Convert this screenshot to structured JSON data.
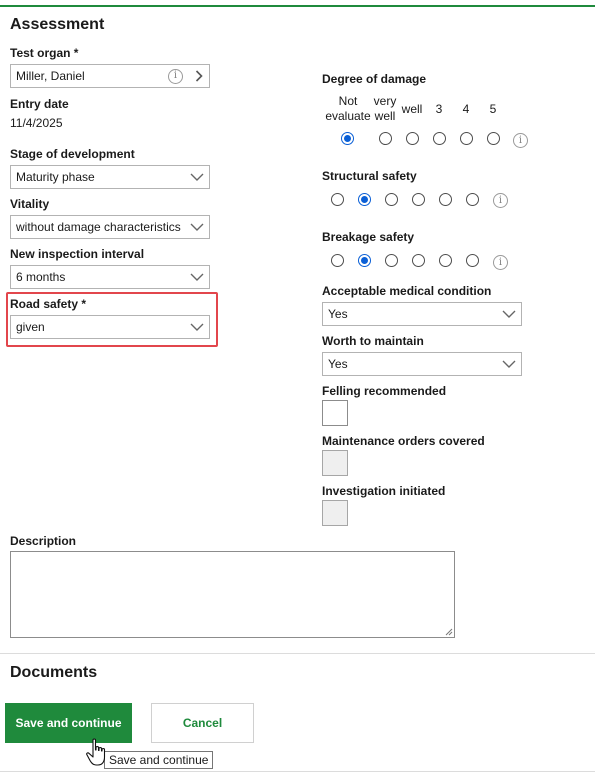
{
  "assessment": {
    "title": "Assessment",
    "test_organ": {
      "label": "Test organ *",
      "value": "Miller, Daniel"
    },
    "entry_date": {
      "label": "Entry date",
      "value": "11/4/2025"
    },
    "stage": {
      "label": "Stage of development",
      "value": "Maturity phase"
    },
    "vitality": {
      "label": "Vitality",
      "value": "without damage characteristics"
    },
    "interval": {
      "label": "New inspection interval",
      "value": "6 months"
    },
    "road_safety": {
      "label": "Road safety *",
      "value": "given"
    }
  },
  "rating_headers": [
    "Not evaluate",
    "very well",
    "well",
    "3",
    "4",
    "5"
  ],
  "degree_of_damage": {
    "label": "Degree of damage",
    "selected_index": 0
  },
  "structural_safety": {
    "label": "Structural safety",
    "selected_index": 1
  },
  "breakage_safety": {
    "label": "Breakage safety",
    "selected_index": 1
  },
  "acceptable_medical": {
    "label": "Acceptable medical condition",
    "value": "Yes"
  },
  "worth_to_maintain": {
    "label": "Worth to maintain",
    "value": "Yes"
  },
  "felling_recommended": {
    "label": "Felling recommended",
    "checked": false
  },
  "maintenance_orders": {
    "label": "Maintenance orders covered",
    "checked": false,
    "disabled": true
  },
  "investigation": {
    "label": "Investigation initiated",
    "checked": false,
    "disabled": true
  },
  "description": {
    "label": "Description",
    "value": ""
  },
  "documents": {
    "title": "Documents"
  },
  "buttons": {
    "save": "Save and continue",
    "cancel": "Cancel"
  },
  "tooltip": {
    "text": "Save and continue"
  },
  "icons": {
    "info": "info-icon",
    "chevron_right": "chevron-right-icon",
    "chevron_down": "chevron-down-icon",
    "cursor": "hand-pointer-icon"
  },
  "colors": {
    "accent": "#1f8a3c",
    "radio_selected": "#0a5fd6",
    "focus_border": "#e2464c"
  }
}
